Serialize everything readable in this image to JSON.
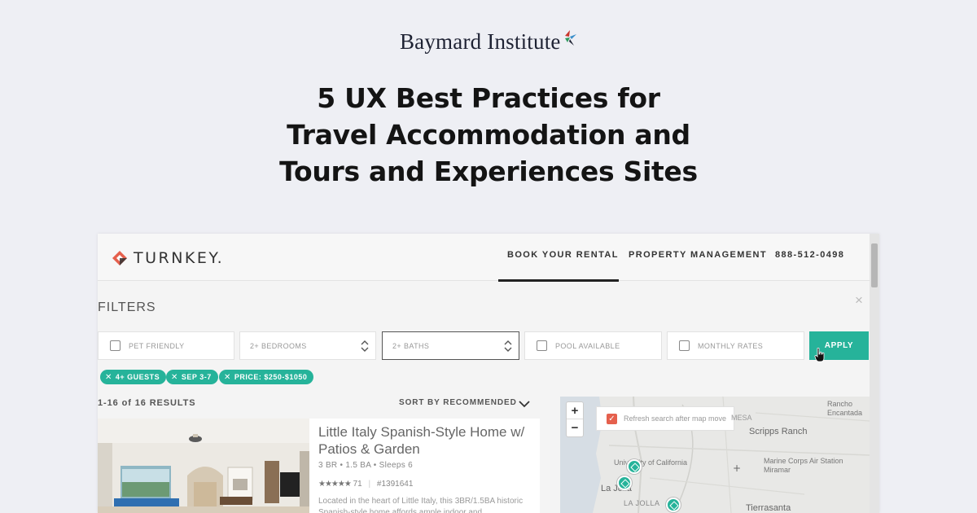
{
  "brand": {
    "name": "Baymard Institute",
    "mark_colors": [
      "#c8372d",
      "#3a8ec9",
      "#2e9b5f",
      "#1e2233"
    ]
  },
  "headline": {
    "line1": "5 UX Best Practices for",
    "line2": "Travel Accommodation and",
    "line3": "Tours and Experiences Sites"
  },
  "site": {
    "logo_text": "TURNKEY.",
    "nav": {
      "book": "BOOK YOUR RENTAL",
      "property": "PROPERTY MANAGEMENT",
      "phone": "888-512-0498"
    },
    "filters": {
      "title": "FILTERS",
      "close": "×",
      "pet_friendly": "PET FRIENDLY",
      "bedrooms": "2+ BEDROOMS",
      "baths": "2+ BATHS",
      "pool": "POOL AVAILABLE",
      "monthly": "MONTHLY RATES",
      "apply": "APPLY"
    },
    "chips": [
      {
        "label": "4+ GUESTS"
      },
      {
        "label": "SEP 3-7"
      },
      {
        "label": "PRICE: $250-$1050"
      }
    ],
    "results": {
      "count": "1-16 of 16 RESULTS",
      "sort": "SORT BY RECOMMENDED"
    },
    "listing": {
      "title": "Little Italy Spanish-Style Home w/ Patios & Garden",
      "meta": "3 BR  •  1.5 BA  •  Sleeps 6",
      "rating_count": "71",
      "listing_id": "#1391641",
      "description": "Located in the heart of Little Italy, this 3BR/1.5BA historic Spanish-style home affords ample indoor and"
    },
    "map": {
      "zoom_in": "+",
      "zoom_out": "−",
      "refresh_label": "Refresh search after map move",
      "places": {
        "rancho": "Rancho Encantada",
        "scripps": "Scripps Ranch",
        "mesa": "MESA",
        "marine": "Marine Corps Air Station Miramar",
        "uc": "University of California",
        "lajolla": "La Jolla",
        "lajolla_caps": "LA JOLLA",
        "tierrasanta": "Tierrasanta"
      }
    },
    "accent": "#26b39a",
    "logo_colors": [
      "#e5604d",
      "#333333"
    ]
  }
}
